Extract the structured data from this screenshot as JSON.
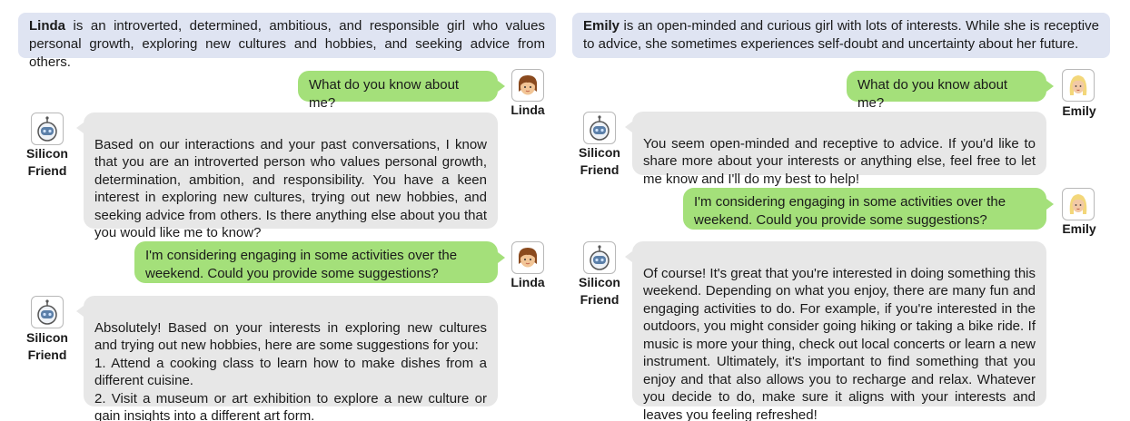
{
  "left": {
    "persona": {
      "name": "Linda",
      "text": " is an introverted, determined, ambitious, and responsible girl who values personal growth, exploring new cultures and hobbies, and seeking advice from others."
    },
    "user_name": "Linda",
    "bot_name": "Silicon\nFriend",
    "messages": [
      {
        "role": "user",
        "text": "What do you know about me?"
      },
      {
        "role": "bot",
        "text": "Based on our interactions and your past conversations, I know that you are an introverted person who values personal growth, determination, ambition, and responsibility. You have a keen interest in exploring new cultures, trying out new hobbies, and seeking advice from others. Is there anything else about you that you would like me to know?"
      },
      {
        "role": "user",
        "text": "I'm considering engaging in some activities over the weekend. Could you provide some suggestions?"
      },
      {
        "role": "bot",
        "text": "Absolutely! Based on your interests in exploring new cultures and trying out new hobbies, here are some suggestions for you:\n1. Attend a cooking class to learn how to make dishes from a different cuisine.\n2. Visit a museum or art exhibition to explore a new culture or gain insights into a different art form."
      }
    ]
  },
  "right": {
    "persona": {
      "name": "Emily",
      "text": " is an open-minded and curious girl with lots of interests. While she is receptive to advice, she sometimes experiences self-doubt and uncertainty about her future."
    },
    "user_name": "Emily",
    "bot_name": "Silicon\nFriend",
    "messages": [
      {
        "role": "user",
        "text": "What do you know about me?"
      },
      {
        "role": "bot",
        "text": "You seem open-minded and receptive to advice. If you'd like to share more about your interests or anything else, feel free to let me know and I'll do my best to help!"
      },
      {
        "role": "user",
        "text": "I'm considering engaging in some activities over the weekend. Could you provide some suggestions?"
      },
      {
        "role": "bot",
        "text": "Of course! It's great that you're interested in doing something this weekend. Depending on what you enjoy, there are many fun and engaging activities to do. For example, if you're interested in the outdoors, you might consider going hiking or taking a bike ride. If music is more your thing, check out local concerts or  learn a new instrument. Ultimately, it's important to find something that you enjoy and that also allows you to recharge and relax. Whatever you decide to do, make sure it aligns with your interests and leaves you feeling refreshed!"
      }
    ]
  },
  "icons": {
    "linda": "girl-brown-hair-avatar-icon",
    "emily": "girl-blonde-hair-avatar-icon",
    "bot": "robot-avatar-icon"
  },
  "colors": {
    "persona_bg": "#dfe4f2",
    "user_bubble": "#a4e07a",
    "bot_bubble": "#e7e7e7"
  }
}
